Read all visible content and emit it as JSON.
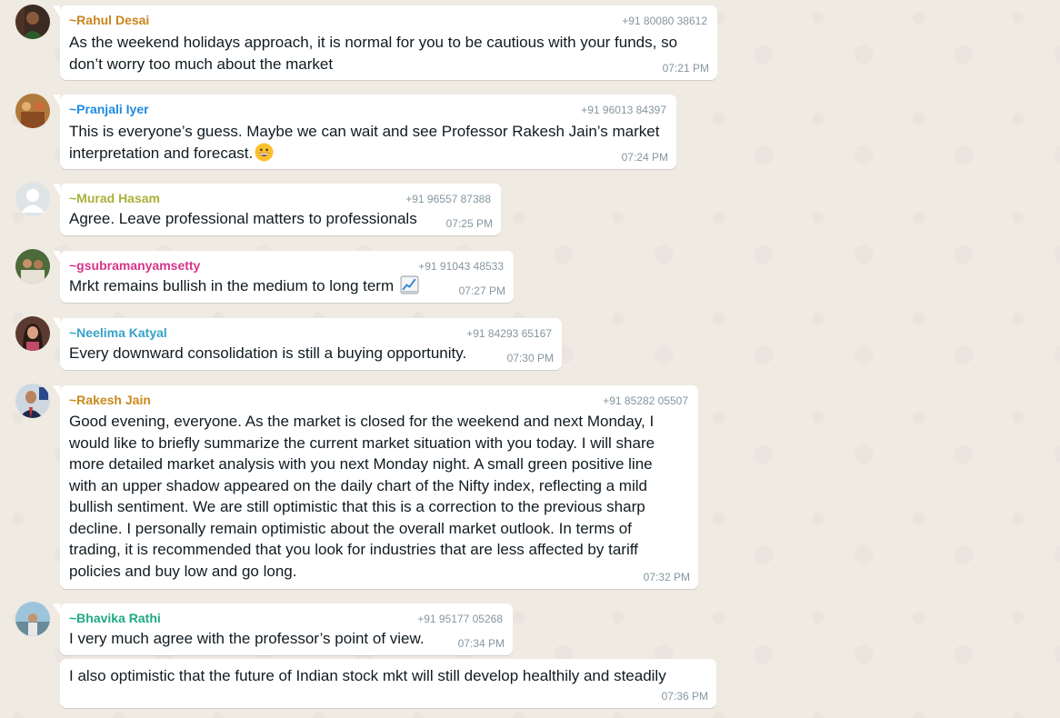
{
  "chat": {
    "colors": {
      "background": "#efeae2",
      "bubble": "#ffffff",
      "meta_text": "#8696a0",
      "message_text": "#111b21"
    },
    "messages": [
      {
        "sender": "~Rahul Desai",
        "phone": "+91 80080 38612",
        "sender_color": "#c9851e",
        "avatar_icon": "profile-photo",
        "text_lines": [
          "As the weekend holidays approach, it is normal for you to be cautious with your funds, so",
          "don’t worry too much about the market"
        ],
        "time": "07:21 PM"
      },
      {
        "sender": "~Pranjali Iyer",
        "phone": "+91 96013 84397",
        "sender_color": "#1f8ae0",
        "avatar_icon": "profile-photo",
        "text_lines": [
          "This is everyone’s guess. Maybe we can wait and see Professor Rakesh Jain’s market",
          "interpretation and forecast."
        ],
        "emoji": "grinning-face-emoji",
        "time": "07:24 PM"
      },
      {
        "sender": "~Murad Hasam",
        "phone": "+91 96557 87388",
        "sender_color": "#a8b23a",
        "avatar_icon": "default-avatar-icon",
        "text_lines": [
          "Agree. Leave professional matters to professionals"
        ],
        "time": "07:25 PM"
      },
      {
        "sender": "~gsubramanyamsetty",
        "phone": "+91 91043 48533",
        "sender_color": "#d6348a",
        "avatar_icon": "profile-photo",
        "text_lines": [
          "Mrkt remains bullish in the medium to long term"
        ],
        "emoji": "chart-increasing-emoji",
        "time": "07:27 PM"
      },
      {
        "sender": "~Neelima Katyal",
        "phone": "+91 84293 65167",
        "sender_color": "#35a3c8",
        "avatar_icon": "profile-photo",
        "text_lines": [
          "Every downward consolidation is still a buying opportunity."
        ],
        "time": "07:30 PM"
      },
      {
        "sender": "~Rakesh Jain",
        "phone": "+91 85282 05507",
        "sender_color": "#c98a1c",
        "avatar_icon": "profile-photo",
        "text_lines": [
          "Good evening, everyone. As the market is closed for the weekend and next Monday, I",
          "would like to briefly summarize the current market situation with you today. I will share",
          "more detailed market analysis with you next Monday night. A small green positive line",
          "with an upper shadow appeared on the daily chart of the Nifty index, reflecting a mild",
          "bullish sentiment. We are still optimistic that this is a correction to the previous sharp",
          "decline. I personally remain optimistic about the overall market outlook. In terms of",
          "trading, it is recommended that you look for industries that are less affected by tariff",
          "policies and buy low and go long."
        ],
        "time": "07:32 PM"
      },
      {
        "sender": "~Bhavika Rathi",
        "phone": "+91 95177 05268",
        "sender_color": "#1fa885",
        "avatar_icon": "profile-photo",
        "text_lines": [
          "I very much agree with the professor’s point of view."
        ],
        "time": "07:34 PM"
      },
      {
        "text_lines": [
          "I also optimistic that the future of  Indian stock mkt will still develop healthily and steadily"
        ],
        "time": "07:36 PM"
      }
    ]
  }
}
